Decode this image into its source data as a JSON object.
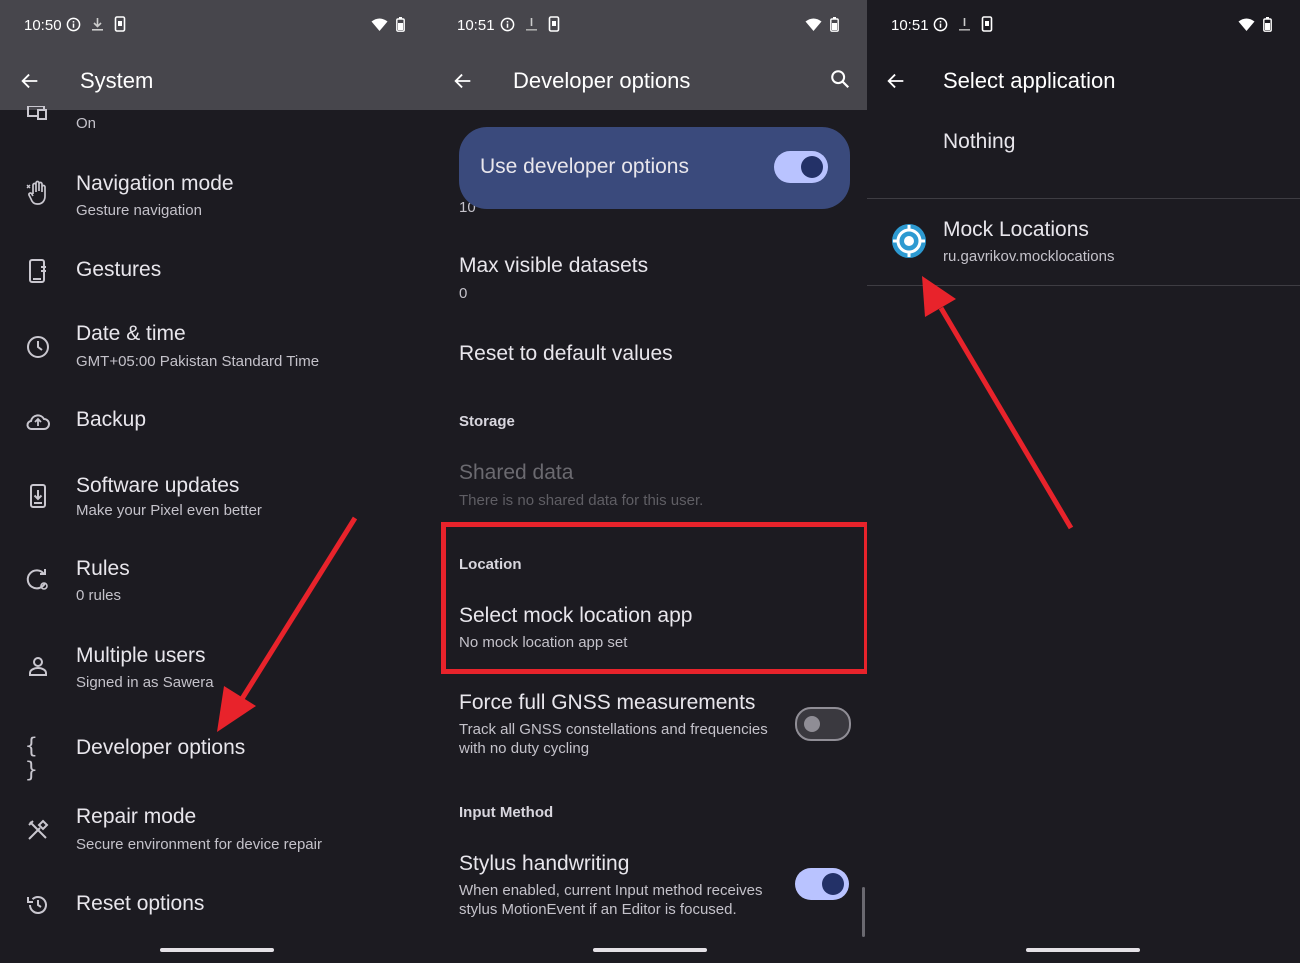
{
  "panel1": {
    "status": {
      "time": "10:50"
    },
    "title": "System",
    "partial_sub": "On",
    "items": [
      {
        "label": "Navigation mode",
        "sub": "Gesture navigation"
      },
      {
        "label": "Gestures",
        "sub": ""
      },
      {
        "label": "Date & time",
        "sub": "GMT+05:00 Pakistan Standard Time"
      },
      {
        "label": "Backup",
        "sub": ""
      },
      {
        "label": "Software updates",
        "sub": "Make your Pixel even better"
      },
      {
        "label": "Rules",
        "sub": "0 rules"
      },
      {
        "label": "Multiple users",
        "sub": "Signed in as Sawera"
      },
      {
        "label": "Developer options",
        "sub": ""
      },
      {
        "label": "Repair mode",
        "sub": "Secure environment for device repair"
      },
      {
        "label": "Reset options",
        "sub": ""
      }
    ],
    "dev_icon_text": "{ }"
  },
  "panel2": {
    "status": {
      "time": "10:51"
    },
    "title": "Developer options",
    "master_toggle": {
      "label": "Use developer options",
      "state": "on"
    },
    "partial_value": "10",
    "max_visible": {
      "label": "Max visible datasets",
      "value": "0"
    },
    "reset": {
      "label": "Reset to default values"
    },
    "storage_header": "Storage",
    "shared": {
      "label": "Shared data",
      "sub": "There is no shared data for this user."
    },
    "location_header": "Location",
    "mock": {
      "label": "Select mock location app",
      "sub": "No mock location app set"
    },
    "gnss": {
      "label": "Force full GNSS measurements",
      "sub1": "Track all GNSS constellations and frequencies",
      "sub2": "with no duty cycling",
      "state": "off"
    },
    "input_header": "Input Method",
    "stylus": {
      "label": "Stylus handwriting",
      "sub1": "When enabled, current Input method receives",
      "sub2": "stylus MotionEvent if an Editor is focused.",
      "state": "on"
    }
  },
  "panel3": {
    "status": {
      "time": "10:51"
    },
    "title": "Select application",
    "nothing": "Nothing",
    "app": {
      "name": "Mock Locations",
      "package": "ru.gavrikov.mocklocations"
    }
  },
  "colors": {
    "highlight": "#e8232b",
    "arrow": "#e8232b",
    "toggle_card": "#3a4a7c",
    "accent": "#b9c3ff"
  }
}
